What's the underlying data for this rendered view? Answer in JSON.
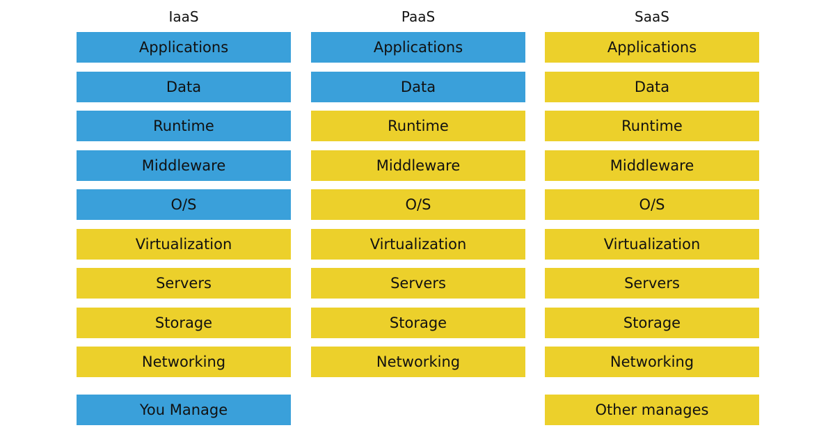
{
  "colors": {
    "you_manage": "#3aa0da",
    "other_manages": "#ecd02b"
  },
  "columns": [
    {
      "title": "IaaS",
      "layers": [
        {
          "label": "Applications",
          "managed_by": "you"
        },
        {
          "label": "Data",
          "managed_by": "you"
        },
        {
          "label": "Runtime",
          "managed_by": "you"
        },
        {
          "label": "Middleware",
          "managed_by": "you"
        },
        {
          "label": "O/S",
          "managed_by": "you"
        },
        {
          "label": "Virtualization",
          "managed_by": "other"
        },
        {
          "label": "Servers",
          "managed_by": "other"
        },
        {
          "label": "Storage",
          "managed_by": "other"
        },
        {
          "label": "Networking",
          "managed_by": "other"
        }
      ]
    },
    {
      "title": "PaaS",
      "layers": [
        {
          "label": "Applications",
          "managed_by": "you"
        },
        {
          "label": "Data",
          "managed_by": "you"
        },
        {
          "label": "Runtime",
          "managed_by": "other"
        },
        {
          "label": "Middleware",
          "managed_by": "other"
        },
        {
          "label": "O/S",
          "managed_by": "other"
        },
        {
          "label": "Virtualization",
          "managed_by": "other"
        },
        {
          "label": "Servers",
          "managed_by": "other"
        },
        {
          "label": "Storage",
          "managed_by": "other"
        },
        {
          "label": "Networking",
          "managed_by": "other"
        }
      ]
    },
    {
      "title": "SaaS",
      "layers": [
        {
          "label": "Applications",
          "managed_by": "other"
        },
        {
          "label": "Data",
          "managed_by": "other"
        },
        {
          "label": "Runtime",
          "managed_by": "other"
        },
        {
          "label": "Middleware",
          "managed_by": "other"
        },
        {
          "label": "O/S",
          "managed_by": "other"
        },
        {
          "label": "Virtualization",
          "managed_by": "other"
        },
        {
          "label": "Servers",
          "managed_by": "other"
        },
        {
          "label": "Storage",
          "managed_by": "other"
        },
        {
          "label": "Networking",
          "managed_by": "other"
        }
      ]
    }
  ],
  "legend": {
    "you_manage": "You Manage",
    "other_manages": "Other manages"
  }
}
